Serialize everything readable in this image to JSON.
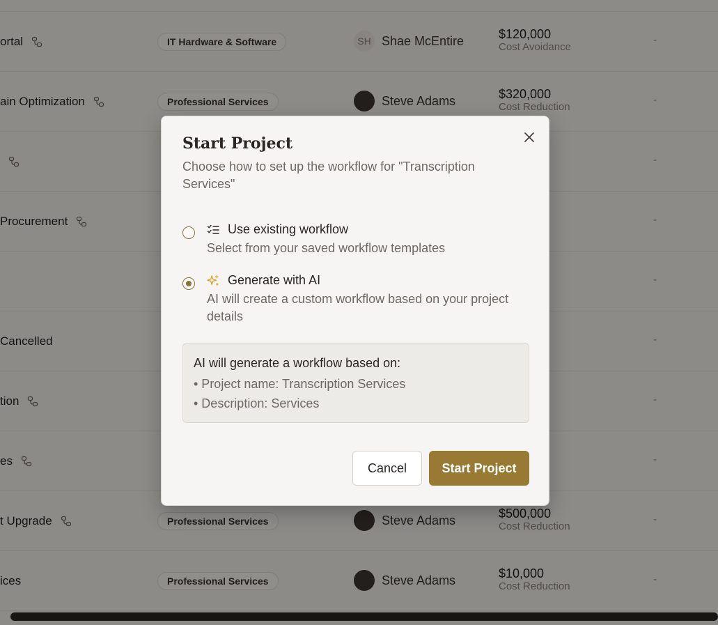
{
  "table": {
    "rows": [
      {
        "name": "ortal",
        "has_link": true,
        "category": "IT Hardware & Software",
        "owner": "Shae McEntire",
        "owner_initials": "SH",
        "amount": "$120,000",
        "value_type": "Cost Avoidance",
        "last": "-"
      },
      {
        "name": "ain Optimization",
        "has_link": true,
        "category": "Professional Services",
        "owner": "Steve Adams",
        "owner_initials": "",
        "amount": "$320,000",
        "value_type": "Cost Reduction",
        "last": "-"
      },
      {
        "name": "",
        "has_link": true,
        "category": "",
        "owner": "",
        "owner_initials": "",
        "amount": "",
        "value_type": "",
        "last": "-"
      },
      {
        "name": "Procurement",
        "has_link": true,
        "category": "",
        "owner": "",
        "owner_initials": "",
        "amount": "",
        "value_type": "",
        "last": "-"
      },
      {
        "name": "",
        "has_link": false,
        "category": "",
        "owner": "",
        "owner_initials": "",
        "amount": "",
        "value_type": "",
        "last": "-"
      },
      {
        "name": "Cancelled",
        "has_link": false,
        "category": "",
        "owner": "",
        "owner_initials": "",
        "amount": "",
        "value_type": "",
        "last": "-"
      },
      {
        "name": "tion",
        "has_link": true,
        "category": "",
        "owner": "",
        "owner_initials": "",
        "amount": "",
        "value_type": "",
        "last": "-"
      },
      {
        "name": "es",
        "has_link": true,
        "category": "",
        "owner": "",
        "owner_initials": "",
        "amount": "",
        "value_type": "",
        "last": "-"
      },
      {
        "name": "t Upgrade",
        "has_link": true,
        "category": "Professional Services",
        "owner": "Steve Adams",
        "owner_initials": "",
        "amount": "$500,000",
        "value_type": "Cost Reduction",
        "last": "-"
      },
      {
        "name": "ices",
        "has_link": false,
        "category": "Professional Services",
        "owner": "Steve Adams",
        "owner_initials": "",
        "amount": "$10,000",
        "value_type": "Cost Reduction",
        "last": "-"
      }
    ]
  },
  "modal": {
    "title": "Start Project",
    "description": "Choose how to set up the workflow for \"Transcription Services\"",
    "options": [
      {
        "label": "Use existing workflow",
        "description": "Select from your saved workflow templates",
        "selected": false,
        "icon": "list-checks-icon"
      },
      {
        "label": "Generate with AI",
        "description": "AI will create a custom workflow based on your project details",
        "selected": true,
        "icon": "sparkles-icon"
      }
    ],
    "info": {
      "title": "AI will generate a workflow based on:",
      "lines": [
        "• Project name: Transcription Services",
        "• Description: Services"
      ]
    },
    "cancel_label": "Cancel",
    "start_label": "Start Project"
  },
  "colors": {
    "accent": "#987a34",
    "overlay": "rgba(0,0,0,0.42)",
    "ai_icon": "#e0a020"
  }
}
